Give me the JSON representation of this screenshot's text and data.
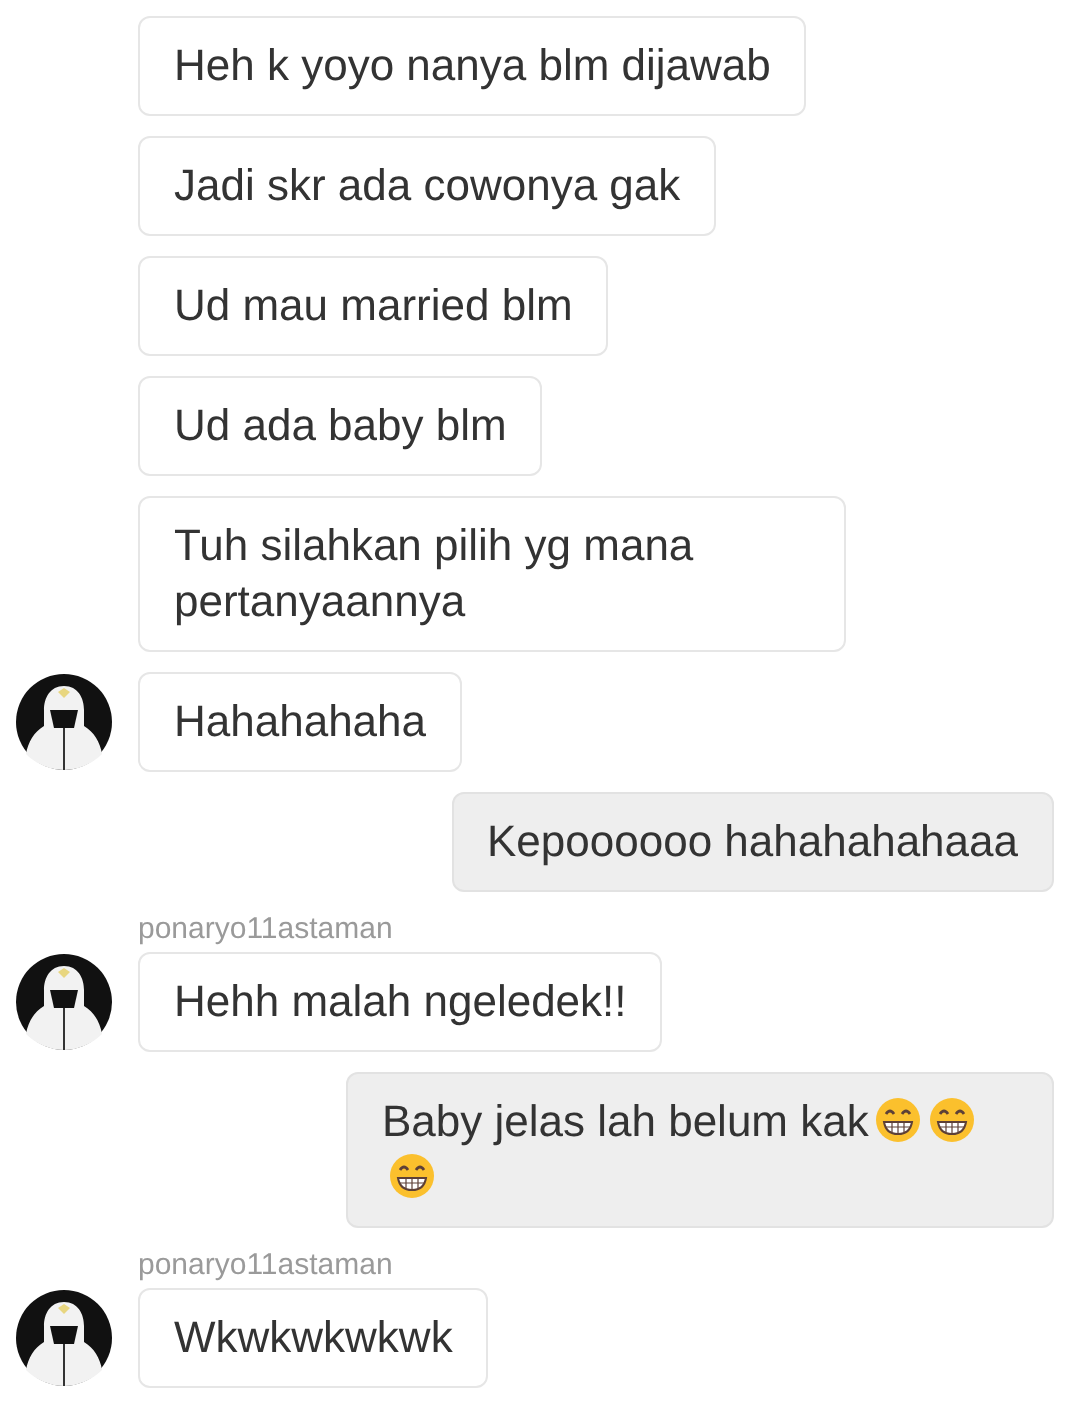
{
  "messages": [
    {
      "kind": "incoming",
      "text": "Heh k yoyo nanya blm dijawab",
      "avatar": false
    },
    {
      "kind": "incoming",
      "text": "Jadi skr ada cowonya gak",
      "avatar": false
    },
    {
      "kind": "incoming",
      "text": "Ud mau married blm",
      "avatar": false
    },
    {
      "kind": "incoming",
      "text": "Ud ada baby blm",
      "avatar": false
    },
    {
      "kind": "incoming",
      "text": "Tuh silahkan pilih yg mana pertanyaannya",
      "avatar": false
    },
    {
      "kind": "incoming",
      "text": "Hahahahaha",
      "avatar": true
    },
    {
      "kind": "outgoing",
      "text": "Kepoooooo hahahahahaaa"
    },
    {
      "kind": "incoming",
      "sender": "ponaryo11astaman",
      "text": "Hehh malah ngeledek!!",
      "avatar": true
    },
    {
      "kind": "outgoing",
      "text": "Baby jelas lah belum kak",
      "emoji": [
        {
          "kind": "grin"
        },
        {
          "kind": "grin"
        },
        {
          "kind": "grin"
        }
      ]
    },
    {
      "kind": "incoming",
      "sender": "ponaryo11astaman",
      "text": "Wkwkwkwkwk",
      "avatar": true
    }
  ]
}
